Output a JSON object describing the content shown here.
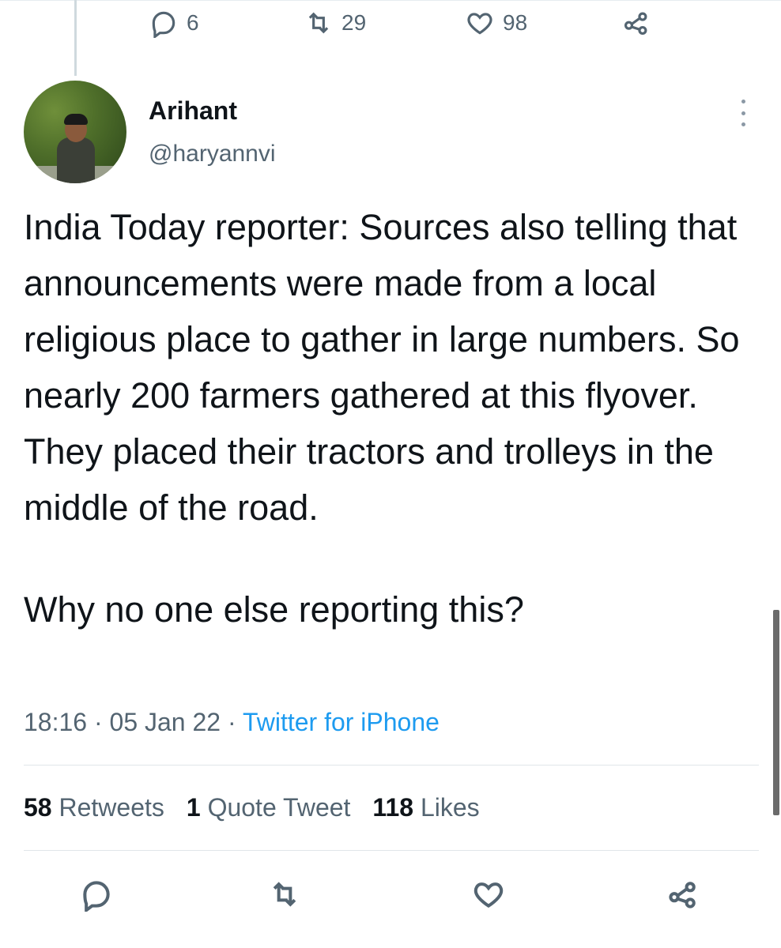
{
  "previous_tweet": {
    "replies": "6",
    "retweets": "29",
    "likes": "98"
  },
  "author": {
    "name": "Arihant",
    "handle": "@haryannvi"
  },
  "tweet": {
    "paragraph1": "India Today reporter: Sources also telling that announcements were made from a local religious place to gather in large numbers. So nearly 200 farmers gathered at this flyover. They placed their tractors and trolleys in the middle of the road.",
    "paragraph2": "Why no one else reporting this?",
    "time": "18:16",
    "date": "05 Jan 22",
    "separator": "·",
    "source": "Twitter for iPhone"
  },
  "stats": {
    "retweets_count": "58",
    "retweets_label": "Retweets",
    "quotes_count": "1",
    "quotes_label": "Quote Tweet",
    "likes_count": "118",
    "likes_label": "Likes"
  },
  "icons": {
    "reply": "reply-icon",
    "retweet": "retweet-icon",
    "like": "heart-icon",
    "share": "share-icon",
    "more": "more-icon"
  },
  "colors": {
    "text": "#0f1419",
    "secondary": "#536471",
    "link": "#1d9bf0",
    "divider": "#e1e6ea"
  }
}
